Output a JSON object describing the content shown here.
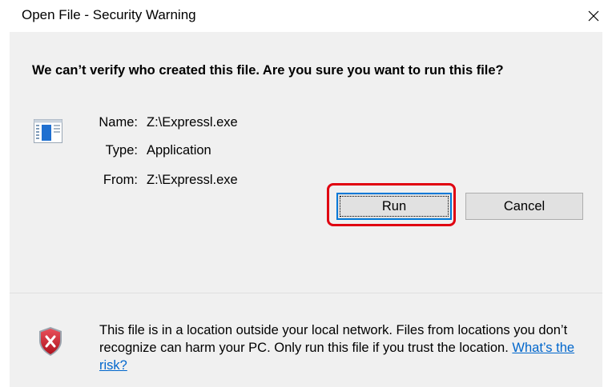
{
  "window": {
    "title": "Open File - Security Warning"
  },
  "dialog": {
    "question": "We can’t verify who created this file. Are you sure you want to run this file?",
    "fields": [
      {
        "label": "Name:",
        "value": "Z:\\Expressl.exe"
      },
      {
        "label": "Type:",
        "value": "Application"
      },
      {
        "label": "From:",
        "value": "Z:\\Expressl.exe"
      }
    ],
    "file_icon": "application-window-icon"
  },
  "buttons": {
    "run_label": "Run",
    "cancel_label": "Cancel",
    "highlight_color": "#e00010"
  },
  "warning": {
    "icon": "shield-x-icon",
    "text": "This file is in a location outside your local network. Files from locations you don’t recognize can harm your PC. Only run this file if you trust the location.",
    "link_text": "What’s the risk?"
  },
  "colors": {
    "panel_bg": "#f0f0f0",
    "focus_blue": "#0078d7",
    "link_blue": "#0066cc",
    "shield_red": "#c8102e"
  }
}
